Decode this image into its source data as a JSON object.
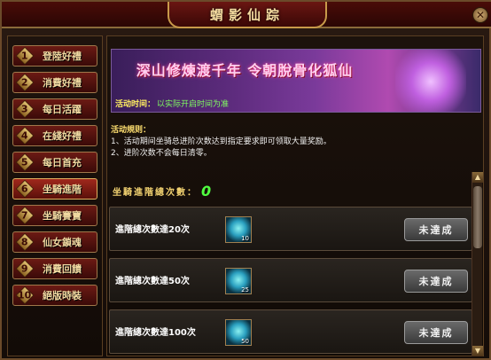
{
  "window": {
    "title": "蝟影仙踪",
    "close_glyph": "✕"
  },
  "sidebar": {
    "items": [
      {
        "num": "1",
        "label": "登陸好禮",
        "active": false
      },
      {
        "num": "2",
        "label": "消費好禮",
        "active": false
      },
      {
        "num": "3",
        "label": "每日活躍",
        "active": false
      },
      {
        "num": "4",
        "label": "在綫好禮",
        "active": false
      },
      {
        "num": "5",
        "label": "每日首充",
        "active": false
      },
      {
        "num": "6",
        "label": "坐騎進階",
        "active": true
      },
      {
        "num": "7",
        "label": "坐騎賽寶",
        "active": false
      },
      {
        "num": "8",
        "label": "仙女鎖魂",
        "active": false
      },
      {
        "num": "9",
        "label": "消費回饋",
        "active": false
      },
      {
        "num": "10",
        "label": "絕版時裝",
        "active": false
      }
    ]
  },
  "banner": {
    "title": "深山修煉渡千年  令朝脫骨化狐仙",
    "time_label": "活动时间：",
    "time_value": "以实际开启时间为准"
  },
  "rules": {
    "heading": "活动規则：",
    "line1": "1、活动期间坐骑总进阶次数达到指定要求即可领取大量奖励。",
    "line2": "2、进阶次数不会每日清零。"
  },
  "total": {
    "label": "坐騎進階總次數：",
    "value": "0"
  },
  "rewards": [
    {
      "label": "進階總次數達20次",
      "count": "10",
      "button": "未達成"
    },
    {
      "label": "進階總次數達50次",
      "count": "25",
      "button": "未達成"
    },
    {
      "label": "進階總次數達100次",
      "count": "50",
      "button": "未達成"
    }
  ],
  "scrollbar": {
    "up_glyph": "▲",
    "down_glyph": "▼"
  }
}
